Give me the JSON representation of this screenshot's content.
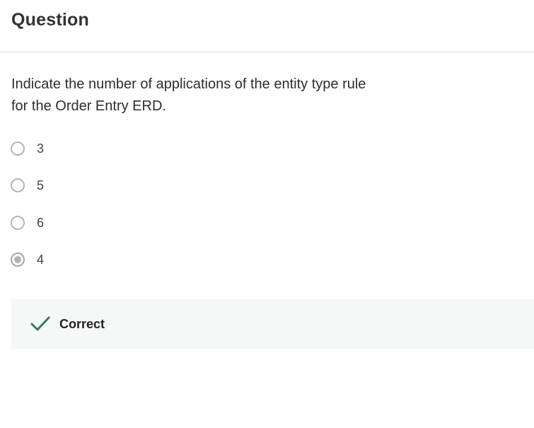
{
  "header": {
    "title": "Question"
  },
  "question": {
    "prompt": "Indicate the number of applications of the entity type rule for the Order Entry ERD.",
    "options": [
      {
        "label": "3",
        "selected": false
      },
      {
        "label": "5",
        "selected": false
      },
      {
        "label": "6",
        "selected": false
      },
      {
        "label": "4",
        "selected": true
      }
    ]
  },
  "feedback": {
    "status": "Correct",
    "icon": "checkmark-icon",
    "color": "#2e7d5b"
  }
}
